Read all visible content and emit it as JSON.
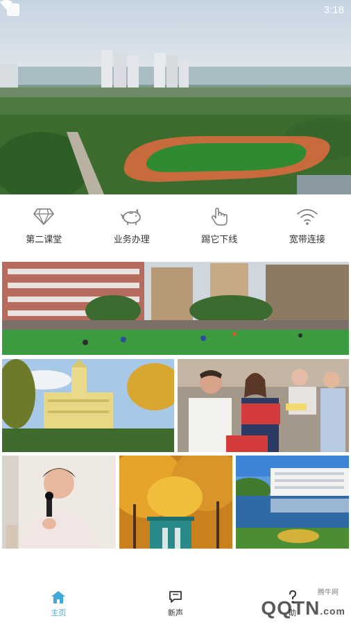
{
  "status_bar": {
    "time": "3:18",
    "icons": [
      "app-square-icon",
      "wifi-icon"
    ]
  },
  "hero": {
    "image_subject": "campus-aerial-stadium"
  },
  "quick_actions": [
    {
      "label": "第二课堂",
      "icon": "diamond-icon"
    },
    {
      "label": "业务办理",
      "icon": "piggy-bank-icon"
    },
    {
      "label": "踢它下线",
      "icon": "hand-pointer-icon"
    },
    {
      "label": "宽带连接",
      "icon": "wifi-signal-icon"
    }
  ],
  "photos": [
    {
      "subject": "campus-soccer-field"
    },
    {
      "subject": "campus-tower-building"
    },
    {
      "subject": "students-with-books"
    },
    {
      "subject": "student-speaking-microphone"
    },
    {
      "subject": "autumn-trees-gate"
    },
    {
      "subject": "campus-lake-building"
    }
  ],
  "bottom_nav": {
    "items": [
      {
        "label": "主页",
        "icon": "home-icon",
        "active": true
      },
      {
        "label": "新声",
        "icon": "chat-icon",
        "active": false
      },
      {
        "label": "助",
        "icon": "question-icon",
        "active": false
      }
    ]
  },
  "watermark": {
    "top": "腾牛网",
    "main": "QQTN",
    "suffix": ".com"
  },
  "colors": {
    "accent": "#3fa9d9",
    "icon_gray": "#7a7a7a",
    "text": "#333333"
  }
}
